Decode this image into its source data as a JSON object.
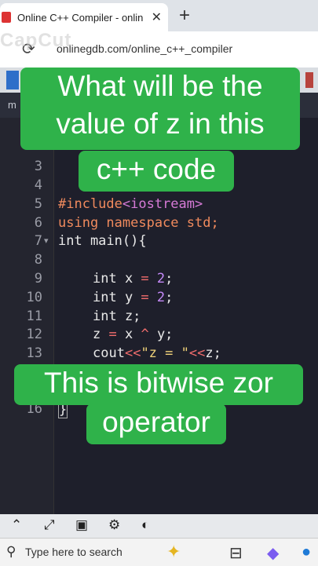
{
  "browser": {
    "tab_title": "Online C++ Compiler - online e",
    "close_glyph": "✕",
    "new_tab_glyph": "+",
    "reload_glyph": "⟳",
    "url": "onlinegdb.com/online_c++_compiler"
  },
  "watermark": "CapCut",
  "file_tab_label": "m",
  "editor": {
    "line_numbers": [
      "3",
      "4",
      "5",
      "6",
      "7",
      "8",
      "9",
      "10",
      "11",
      "12",
      "13",
      "16"
    ],
    "lines": {
      "l5_pp": "#include",
      "l5_inc": "<iostream>",
      "l6": "using namespace std;",
      "l7": "int main(){",
      "l9_a": "int x ",
      "l9_op": "=",
      "l9_num": "2",
      "l9_end": ";",
      "l10_a": "int y ",
      "l10_op": "=",
      "l10_num": "2",
      "l10_end": ";",
      "l11": "int z;",
      "l12_a": "z ",
      "l12_op1": "=",
      "l12_b": " x ",
      "l12_op2": "^",
      "l12_c": " y;",
      "l13_a": "cout",
      "l13_op": "<<",
      "l13_str": "\"z = \"",
      "l13_op2": "<<",
      "l13_end": "z;",
      "l16": "}"
    }
  },
  "overlays": {
    "top_line1": "What will be the",
    "top_line2": "value of z in this",
    "top_line3": "c++ code",
    "bottom_line1": "This is bitwise zor",
    "bottom_line2": "operator"
  },
  "taskbar": {
    "search_placeholder": "Type here to search"
  }
}
